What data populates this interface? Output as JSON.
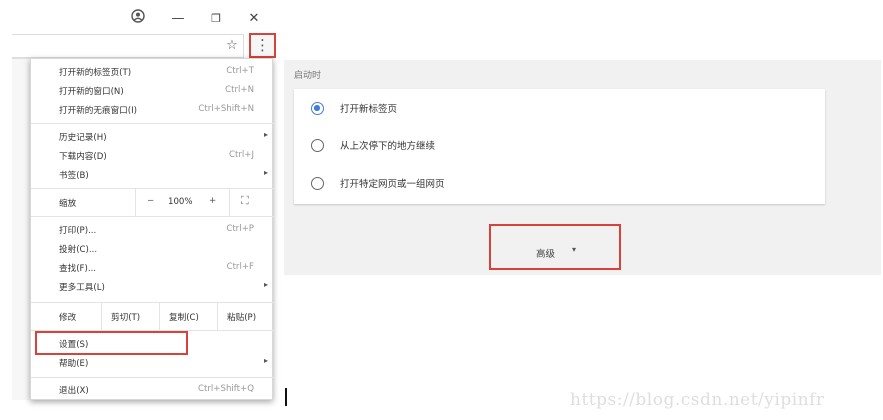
{
  "window": {
    "profile_icon": "account-circle-icon",
    "minimize_glyph": "—",
    "restore_glyph": "❐",
    "close_glyph": "✕"
  },
  "toolbar": {
    "star_glyph": "☆",
    "menu_glyph": "⋮"
  },
  "menu": {
    "items_group1": [
      {
        "label": "打开新的标签页(T)",
        "shortcut": "Ctrl+T"
      },
      {
        "label": "打开新的窗口(N)",
        "shortcut": "Ctrl+N"
      },
      {
        "label": "打开新的无痕窗口(I)",
        "shortcut": "Ctrl+Shift+N"
      }
    ],
    "items_group2": [
      {
        "label": "历史记录(H)",
        "shortcut": ""
      },
      {
        "label": "下载内容(D)",
        "shortcut": "Ctrl+J"
      },
      {
        "label": "书签(B)",
        "shortcut": ""
      }
    ],
    "zoom": {
      "label": "缩放",
      "minus": "−",
      "value": "100%",
      "plus": "+",
      "fullscreen_glyph": "⛶"
    },
    "items_group3": [
      {
        "label": "打印(P)...",
        "shortcut": "Ctrl+P"
      },
      {
        "label": "投射(C)...",
        "shortcut": ""
      },
      {
        "label": "查找(F)...",
        "shortcut": "Ctrl+F"
      },
      {
        "label": "更多工具(L)",
        "shortcut": ""
      }
    ],
    "edit": {
      "label": "修改",
      "cut": "剪切(T)",
      "copy": "复制(C)",
      "paste": "粘贴(P)"
    },
    "items_group4": [
      {
        "label": "设置(S)",
        "shortcut": ""
      },
      {
        "label": "帮助(E)",
        "shortcut": ""
      }
    ],
    "exit": {
      "label": "退出(X)",
      "shortcut": "Ctrl+Shift+Q"
    },
    "submenu_arrow": "▸"
  },
  "settings": {
    "startup_label": "启动时",
    "options": [
      {
        "label": "打开新标签页",
        "checked": true
      },
      {
        "label": "从上次停下的地方继续",
        "checked": false
      },
      {
        "label": "打开特定网页或一组网页",
        "checked": false
      }
    ],
    "advanced_label": "高级",
    "advanced_caret": "▾"
  },
  "watermark": "https://blog.csdn.net/yipinfr",
  "colors": {
    "highlight": "#d9413b",
    "radio_accent": "#3e7fd8"
  }
}
